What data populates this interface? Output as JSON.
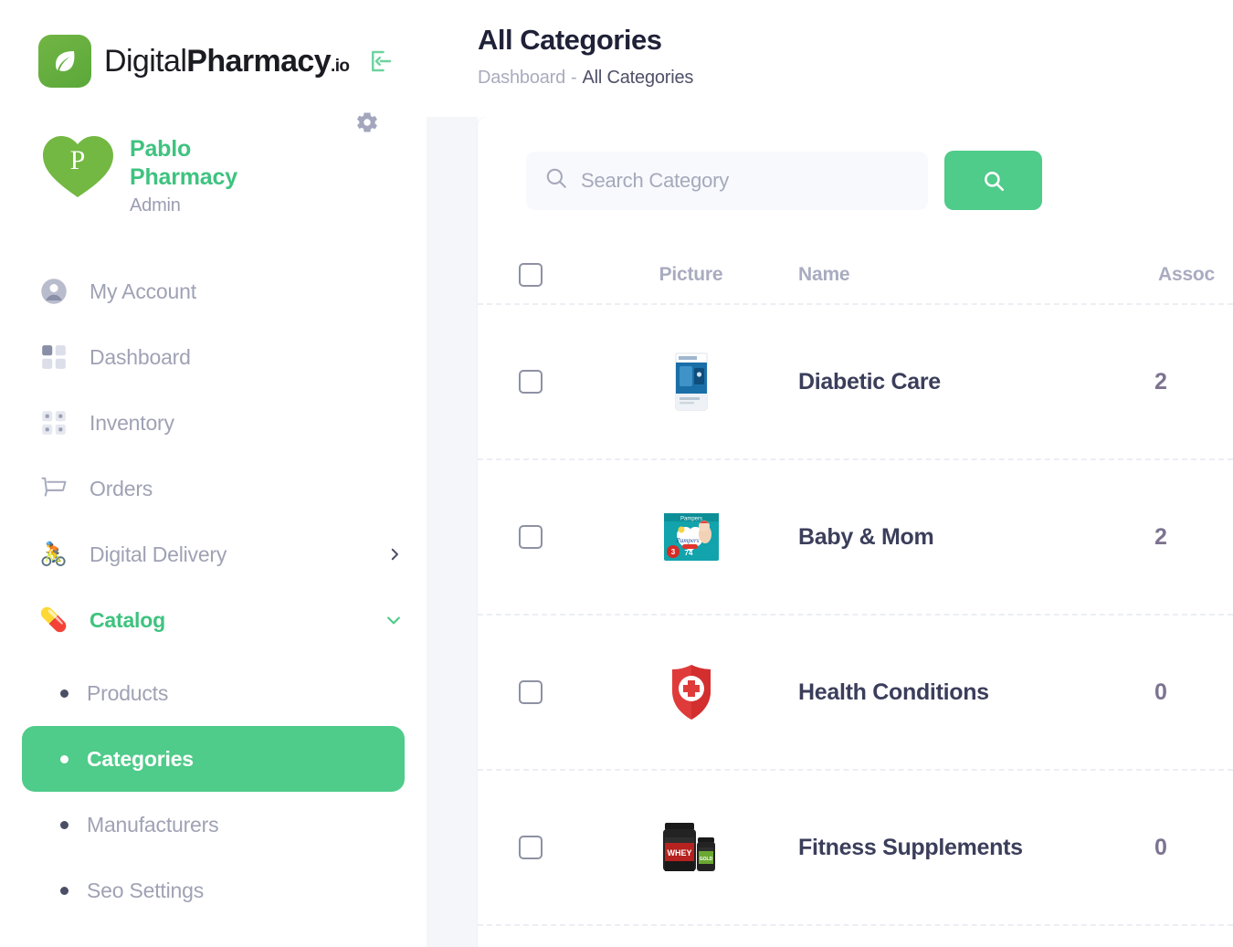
{
  "brand": {
    "name_light": "Digital",
    "name_bold": "Pharmacy",
    "tld": ".io",
    "leaf_icon": "leaf-icon",
    "collapse_icon": "collapse-sidebar-icon"
  },
  "profile": {
    "avatar_letter": "P",
    "name": "Pablo Pharmacy",
    "role": "Admin",
    "settings_icon": "gear-icon"
  },
  "sidebar": {
    "items": [
      {
        "label": "My Account",
        "icon": "user-circle-icon",
        "active": false,
        "chevron": ""
      },
      {
        "label": "Dashboard",
        "icon": "grid-squares-icon",
        "active": false,
        "chevron": ""
      },
      {
        "label": "Inventory",
        "icon": "inventory-grid-icon",
        "active": false,
        "chevron": ""
      },
      {
        "label": "Orders",
        "icon": "shopping-cart-icon",
        "active": false,
        "chevron": ""
      },
      {
        "label": "Digital Delivery",
        "icon": "cyclist-icon",
        "active": false,
        "chevron": "chevron-right-icon"
      },
      {
        "label": "Catalog",
        "icon": "pill-capsule-icon",
        "active": true,
        "chevron": "chevron-down-icon"
      }
    ],
    "sub_items": [
      {
        "label": "Products",
        "active": false
      },
      {
        "label": "Categories",
        "active": true
      },
      {
        "label": "Manufacturers",
        "active": false
      },
      {
        "label": "Seo Settings",
        "active": false
      }
    ]
  },
  "header": {
    "title": "All Categories",
    "breadcrumb_parent": "Dashboard",
    "breadcrumb_sep": "-",
    "breadcrumb_current": "All Categories"
  },
  "search": {
    "placeholder": "Search Category",
    "value": "",
    "icon": "search-icon",
    "button_icon": "search-icon"
  },
  "table": {
    "columns": [
      "",
      "Picture",
      "Name",
      "Assoc"
    ],
    "rows": [
      {
        "name": "Diabetic Care",
        "associated": "2",
        "picture": "diabetic-test-kit-box",
        "checked": false
      },
      {
        "name": "Baby & Mom",
        "associated": "2",
        "picture": "diaper-pack-box",
        "checked": false
      },
      {
        "name": "Health Conditions",
        "associated": "0",
        "picture": "red-shield-cross",
        "checked": false
      },
      {
        "name": "Fitness Supplements",
        "associated": "0",
        "picture": "protein-tubs",
        "checked": false
      }
    ]
  },
  "colors": {
    "accent_green": "#4fcb8a",
    "brand_green": "#3ec37f",
    "muted_text": "#9fa2b4",
    "dark_text": "#3b3e5b"
  }
}
